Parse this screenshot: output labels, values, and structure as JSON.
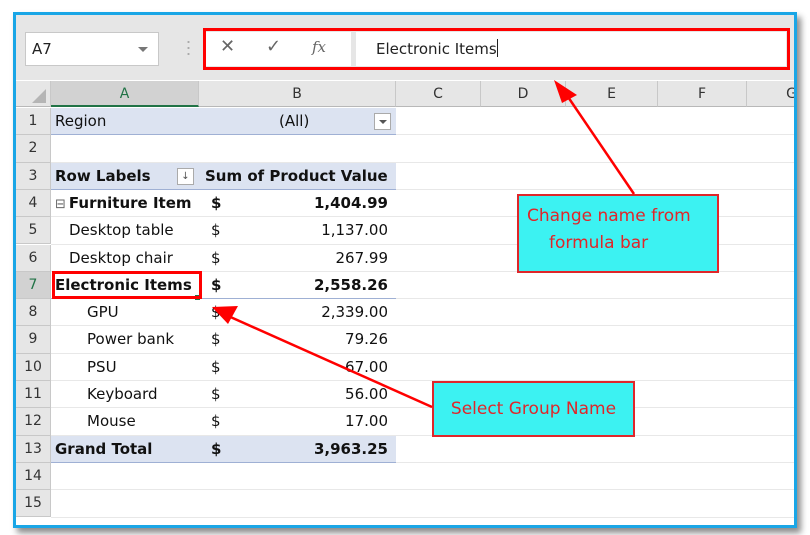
{
  "name_box": {
    "value": "A7"
  },
  "formula_bar": {
    "cancel_icon": "✕",
    "enter_icon": "✓",
    "fx_label": "fx",
    "value": "Electronic Items"
  },
  "columns": [
    "A",
    "B",
    "C",
    "D",
    "E",
    "F",
    "G"
  ],
  "selected_column": "A",
  "rows": [
    "1",
    "2",
    "3",
    "4",
    "5",
    "6",
    "7",
    "8",
    "9",
    "10",
    "11",
    "12",
    "13",
    "14",
    "15"
  ],
  "selected_row": "7",
  "pivot": {
    "filter": {
      "label": "Region",
      "value": "(All)"
    },
    "header": {
      "row_labels": "Row Labels",
      "value_header": "Sum of Product Value"
    },
    "currency_symbol": "$",
    "groups": [
      {
        "label": "Furniture Item",
        "total": "1,404.99",
        "collapse_icon": "⊟",
        "items": [
          {
            "label": "Desktop table",
            "value": "1,137.00"
          },
          {
            "label": "Desktop chair",
            "value": "267.99"
          }
        ]
      },
      {
        "label": "Electronic Items",
        "total": "2,558.26",
        "items": [
          {
            "label": "GPU",
            "value": "2,339.00"
          },
          {
            "label": "Power bank",
            "value": "79.26"
          },
          {
            "label": "PSU",
            "value": "67.00"
          },
          {
            "label": "Keyboard",
            "value": "56.00"
          },
          {
            "label": "Mouse",
            "value": "17.00"
          }
        ]
      }
    ],
    "grand_total": {
      "label": "Grand Total",
      "value": "3,963.25"
    }
  },
  "annotations": {
    "callout_formula": {
      "line1": "Change name from",
      "line2": "formula bar"
    },
    "callout_select": {
      "text": "Select Group Name"
    },
    "color_red": "#ff0000",
    "color_cyan": "#3cf2f2"
  }
}
